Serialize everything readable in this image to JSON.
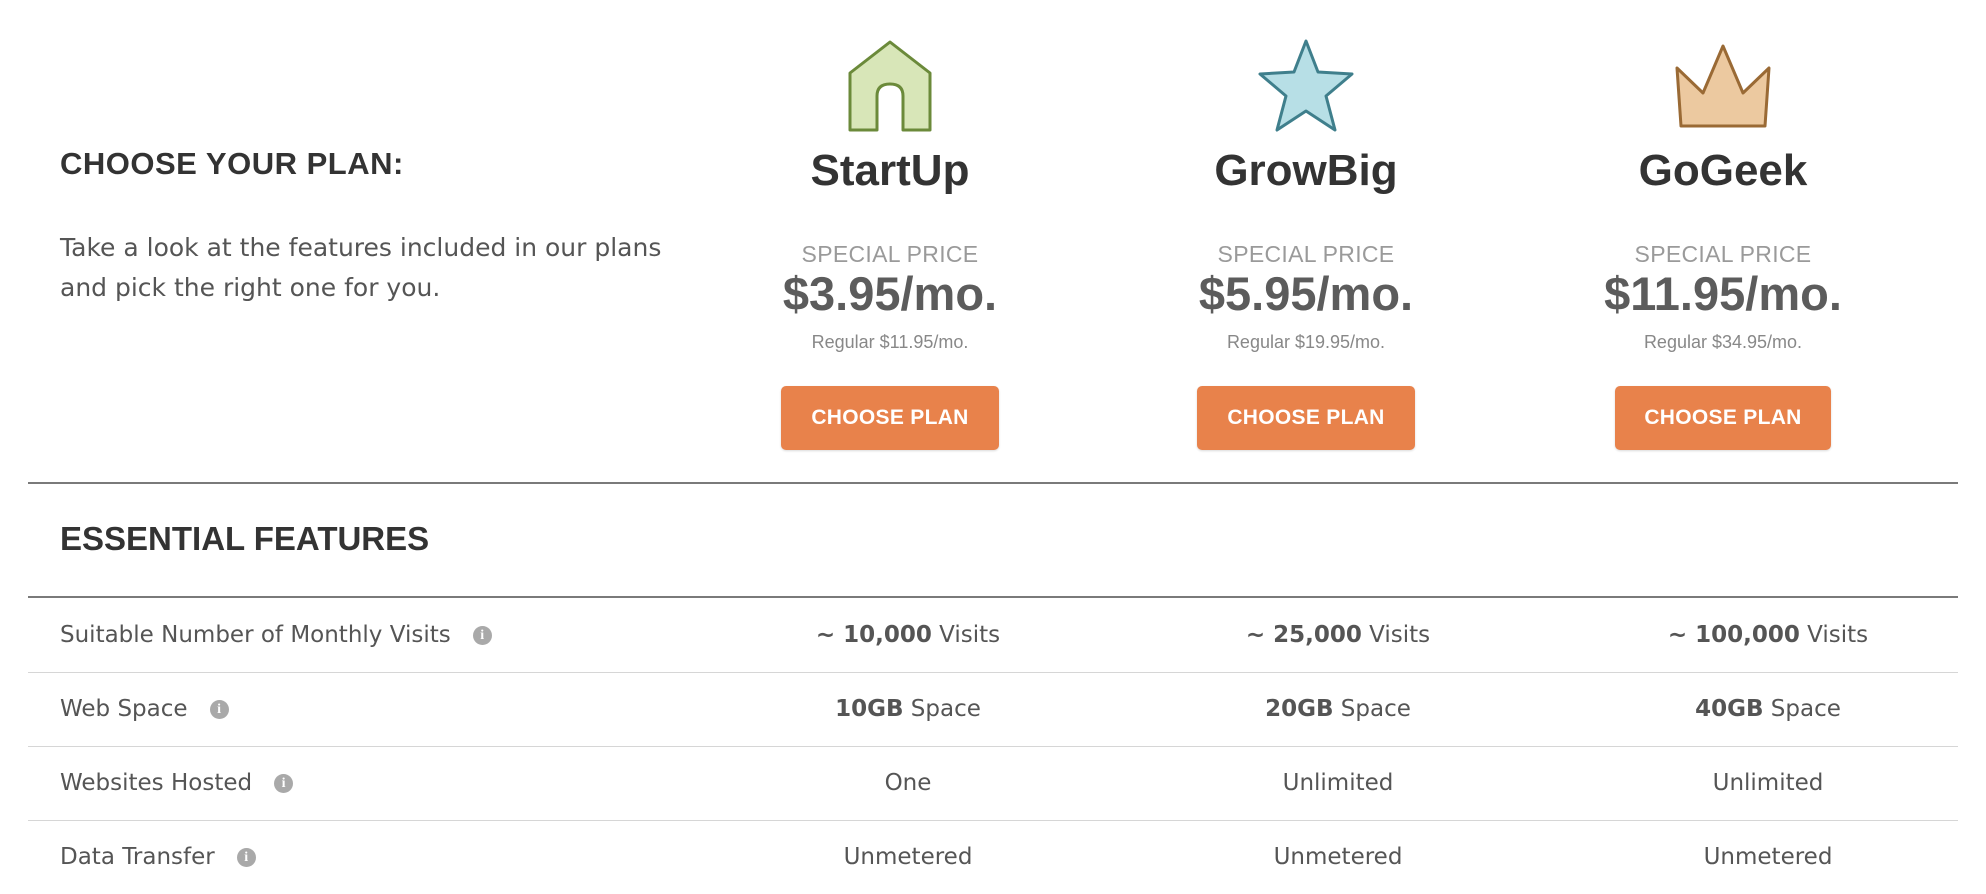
{
  "intro": {
    "title": "CHOOSE YOUR PLAN:",
    "description": "Take a look at the features included in our plans and pick the right one for you."
  },
  "plans": [
    {
      "name": "StartUp",
      "icon": "house-icon",
      "special_label": "SPECIAL PRICE",
      "price": "$3.95/mo.",
      "regular": "Regular $11.95/mo.",
      "button_label": "CHOOSE PLAN"
    },
    {
      "name": "GrowBig",
      "icon": "star-icon",
      "special_label": "SPECIAL PRICE",
      "price": "$5.95/mo.",
      "regular": "Regular $19.95/mo.",
      "button_label": "CHOOSE PLAN"
    },
    {
      "name": "GoGeek",
      "icon": "crown-icon",
      "special_label": "SPECIAL PRICE",
      "price": "$11.95/mo.",
      "regular": "Regular $34.95/mo.",
      "button_label": "CHOOSE PLAN"
    }
  ],
  "features": {
    "section_title": "ESSENTIAL FEATURES",
    "info_glyph": "i",
    "rows": [
      {
        "label": "Suitable Number of Monthly Visits",
        "values": [
          {
            "bold": "~ 10,000",
            "rest": " Visits"
          },
          {
            "bold": "~ 25,000",
            "rest": " Visits"
          },
          {
            "bold": "~ 100,000",
            "rest": " Visits"
          }
        ]
      },
      {
        "label": "Web Space",
        "values": [
          {
            "bold": "10GB",
            "rest": " Space"
          },
          {
            "bold": "20GB",
            "rest": " Space"
          },
          {
            "bold": "40GB",
            "rest": " Space"
          }
        ]
      },
      {
        "label": "Websites Hosted",
        "values": [
          {
            "bold": "",
            "rest": "One"
          },
          {
            "bold": "",
            "rest": "Unlimited"
          },
          {
            "bold": "",
            "rest": "Unlimited"
          }
        ]
      },
      {
        "label": "Data Transfer",
        "values": [
          {
            "bold": "",
            "rest": "Unmetered"
          },
          {
            "bold": "",
            "rest": "Unmetered"
          },
          {
            "bold": "",
            "rest": "Unmetered"
          }
        ]
      }
    ]
  },
  "colors": {
    "button": "#e8824b",
    "house_fill": "#d8e6b8",
    "house_stroke": "#6b8a3a",
    "star_fill": "#b7dfe6",
    "star_stroke": "#3f7f8c",
    "crown_fill": "#ecc9a0",
    "crown_stroke": "#9a6a35"
  }
}
